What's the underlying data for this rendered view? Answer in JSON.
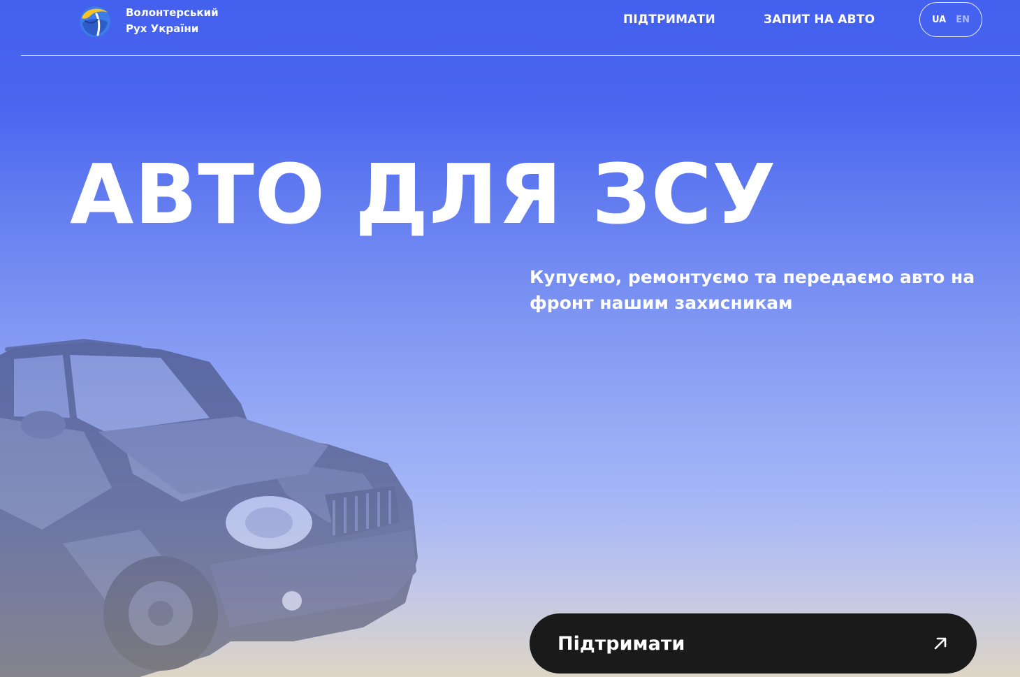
{
  "header": {
    "logo": {
      "icon": "ukraine-movement-logo-icon",
      "line1": "Волонтерський",
      "line2": "Рух України"
    },
    "nav": {
      "support_label": "ПІДТРИМАТИ",
      "request_label": "ЗАПИТ НА АВТО"
    },
    "lang": {
      "ua_label": "UA",
      "en_label": "EN",
      "selected": "UA"
    }
  },
  "hero": {
    "title": "АВТО ДЛЯ ЗСУ",
    "subtitle": "Купуємо, ремонтуємо та передаємо авто на фронт нашим захисникам",
    "button_label": "Підтримати",
    "button_icon": "arrow-up-right-icon",
    "image": "suv-car-image"
  },
  "colors": {
    "gradient_top": "#4360ef",
    "gradient_bottom": "#ddd5c5",
    "button_bg": "#1a1a1a",
    "text": "#ffffff"
  }
}
